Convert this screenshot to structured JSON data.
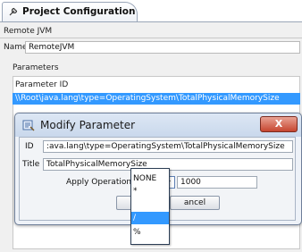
{
  "tab": {
    "title": "Project Configuration"
  },
  "config": {
    "remote_jvm_label": "Remote JVM",
    "name_label": "Name",
    "name_value": "RemoteJVM",
    "parameters_label": "Parameters",
    "param_id_header": "Parameter ID",
    "selected_row": "\\\\Root\\java.lang\\type=OperatingSystem\\TotalPhysicalMemorySize"
  },
  "dialog": {
    "title": "Modify Parameter",
    "close_label": "X",
    "id_label": "ID",
    "id_value": ":ava.lang\\type=OperatingSystem\\TotalPhysicalMemorySize",
    "title_label": "Title",
    "title_value": "TotalPhysicalMemorySize",
    "apply_label": "Apply Operation",
    "operation_value": "/",
    "operand_value": "1000",
    "ok_label": "O",
    "cancel_label": "ancel"
  },
  "dropdown": {
    "options": [
      "NONE",
      "*",
      "/",
      "%"
    ],
    "selected_index": 2
  },
  "colors": {
    "selection": "#3399ff",
    "close_button": "#c6452f"
  }
}
